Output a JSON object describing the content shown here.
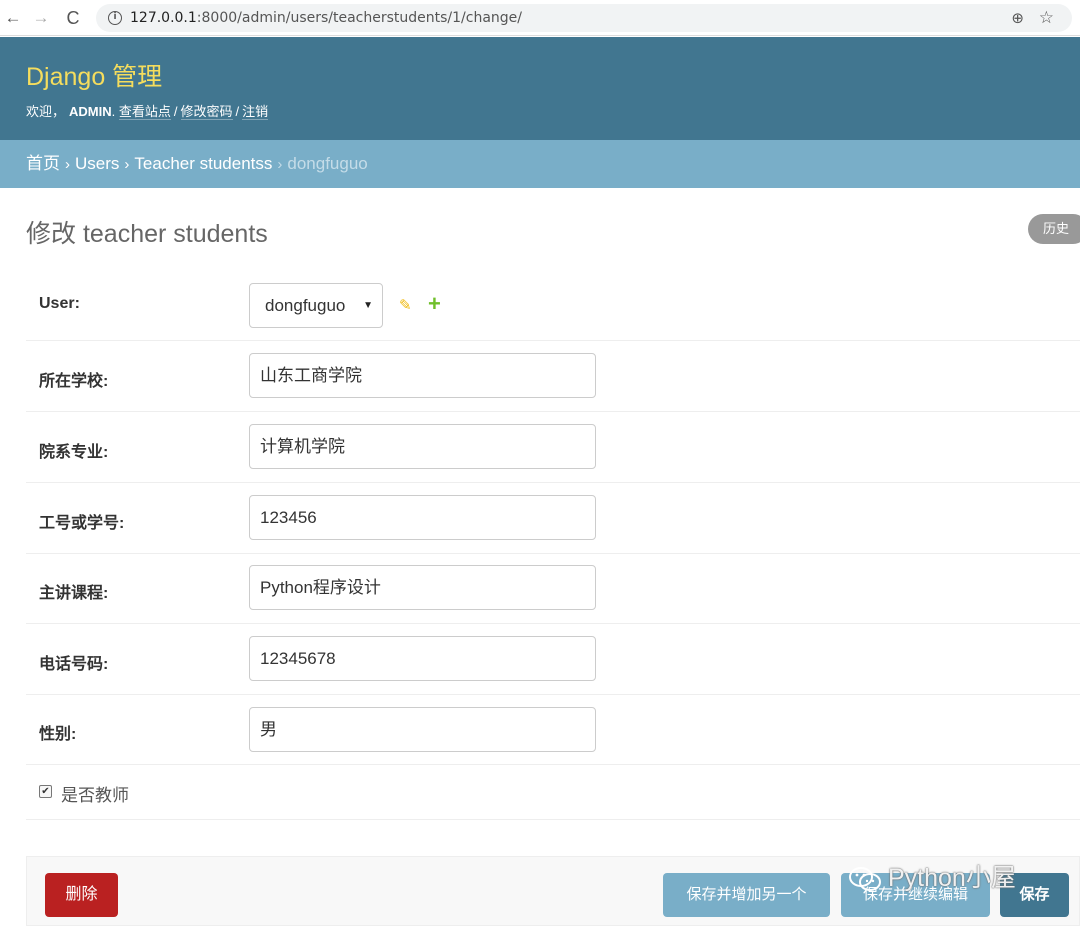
{
  "browser": {
    "back": "←",
    "forward": "→",
    "reload": "C",
    "info": "i",
    "url_host": "127.0.0.1",
    "url_rest": ":8000/admin/users/teacherstudents/1/change/",
    "icons": [
      "back-arrow-icon",
      "forward-arrow-icon",
      "reload-icon",
      "info-icon",
      "zoom-icon",
      "star-icon"
    ]
  },
  "header": {
    "branding": "Django 管理",
    "welcome": "欢迎，",
    "username": "ADMIN",
    "view_site": "查看站点",
    "change_password": "修改密码",
    "logout": "注销"
  },
  "breadcrumbs": {
    "home": "首页",
    "app": "Users",
    "model": "Teacher studentss",
    "current": "dongfuguo"
  },
  "page": {
    "title": "修改 teacher students",
    "history": "历史"
  },
  "form": {
    "user_label": "User:",
    "user_value": "dongfuguo",
    "school_label": "所在学校:",
    "school_value": "山东工商学院",
    "department_label": "院系专业:",
    "department_value": "计算机学院",
    "number_label": "工号或学号:",
    "number_value": "123456",
    "course_label": "主讲课程:",
    "course_value": "Python程序设计",
    "phone_label": "电话号码:",
    "phone_value": "12345678",
    "gender_label": "性别:",
    "gender_value": "男",
    "is_teacher_label": "是否教师",
    "is_teacher_checked": true
  },
  "actions": {
    "delete": "删除",
    "save_add_another": "保存并增加另一个",
    "save_continue": "保存并继续编辑",
    "save": "保存"
  },
  "watermark": "Python小屋",
  "colors": {
    "header_bg": "#417690",
    "branding": "#f5dd5d",
    "breadcrumbs_bg": "#79aec8",
    "delete_bg": "#ba2121",
    "save_bg": "#417690",
    "secondary_btn_bg": "#79aec8"
  }
}
